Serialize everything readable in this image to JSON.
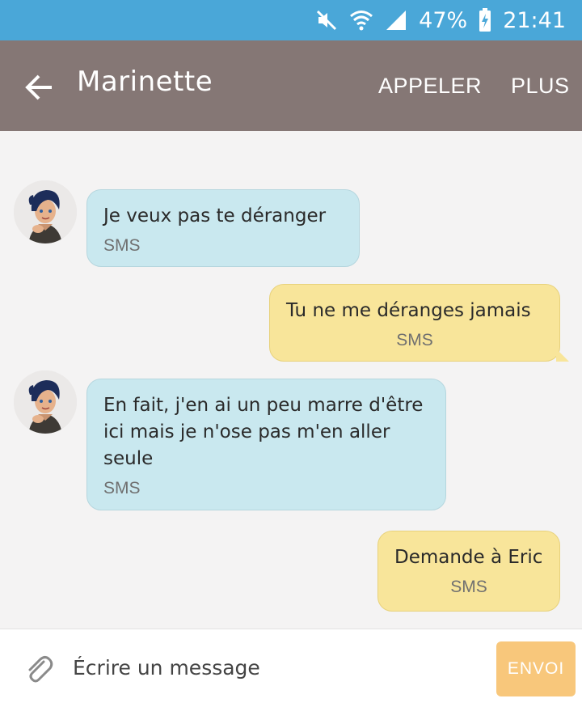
{
  "status_bar": {
    "battery": "47%",
    "time": "21:41",
    "icons": [
      "mute-icon",
      "wifi-icon",
      "signal-icon",
      "battery-charging-icon"
    ]
  },
  "header": {
    "contact_name": "Marinette",
    "call_label": "APPELER",
    "more_label": "PLUS",
    "back_icon": "back-arrow-icon"
  },
  "messages": [
    {
      "direction": "incoming",
      "text": "Je veux pas te déranger",
      "meta": "SMS"
    },
    {
      "direction": "outgoing",
      "text": "Tu ne me déranges jamais",
      "meta": "SMS"
    },
    {
      "direction": "incoming",
      "text": "En fait, j'en ai un peu marre d'être ici mais je n'ose pas m'en aller seule",
      "meta": "SMS"
    },
    {
      "direction": "outgoing",
      "text": "Demande à Eric",
      "meta": "SMS"
    }
  ],
  "composer": {
    "placeholder": "Écrire un message",
    "send_label": "ENVOI",
    "attach_icon": "paperclip-icon"
  },
  "colors": {
    "status_bar": "#4aa7d8",
    "app_bar": "#857775",
    "incoming_bubble": "#c9e8ef",
    "outgoing_bubble": "#f8e59a",
    "send_button": "#f8c77b"
  }
}
